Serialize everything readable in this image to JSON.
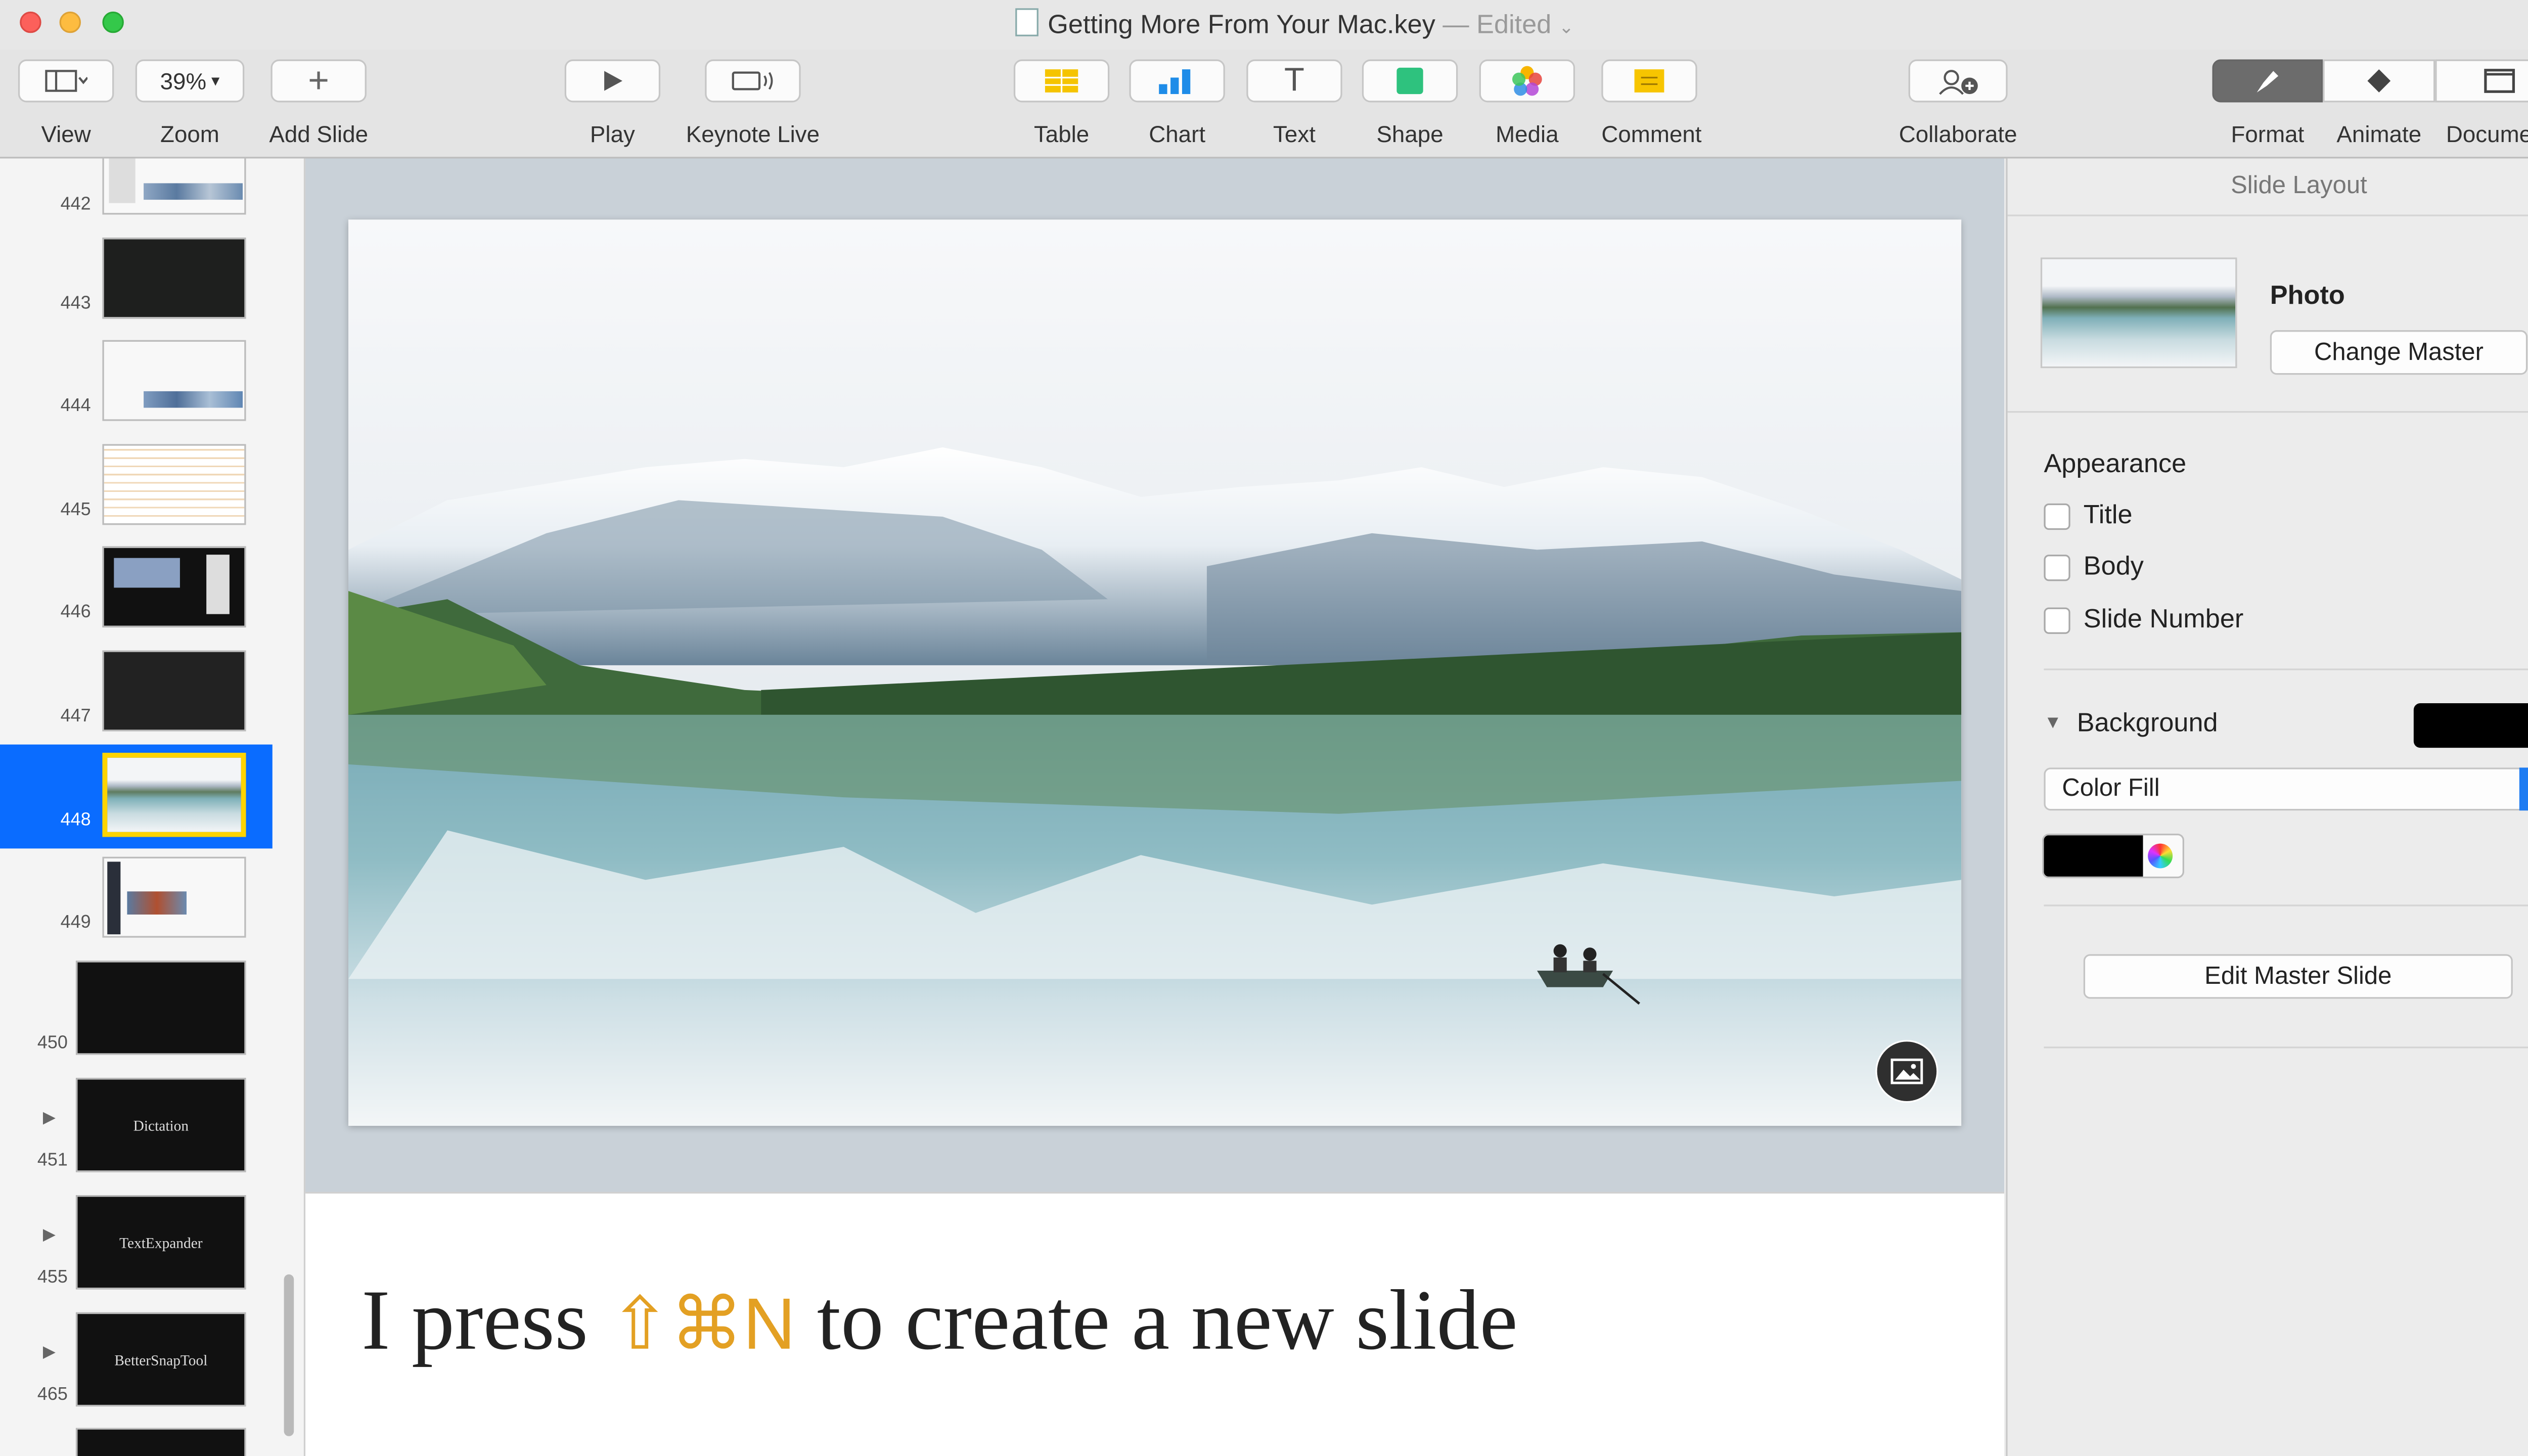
{
  "window": {
    "title": "Getting More From Your Mac.key",
    "edited": "— Edited"
  },
  "toolbar": {
    "view": "View",
    "zoom": "Zoom",
    "zoom_value": "39%",
    "add_slide": "Add Slide",
    "play": "Play",
    "keynote_live": "Keynote Live",
    "table": "Table",
    "chart": "Chart",
    "text": "Text",
    "shape": "Shape",
    "media": "Media",
    "comment": "Comment",
    "collaborate": "Collaborate",
    "format": "Format",
    "animate": "Animate",
    "document": "Document"
  },
  "slides": [
    {
      "num": "442",
      "style": "light"
    },
    {
      "num": "443",
      "style": "dark"
    },
    {
      "num": "444",
      "style": "light"
    },
    {
      "num": "445",
      "style": "light"
    },
    {
      "num": "446",
      "style": "dark"
    },
    {
      "num": "447",
      "style": "dark"
    },
    {
      "num": "448",
      "style": "photo",
      "selected": true
    },
    {
      "num": "449",
      "style": "light"
    },
    {
      "num": "450",
      "style": "dark"
    },
    {
      "num": "451",
      "style": "dark",
      "label": "Dictation",
      "group": true
    },
    {
      "num": "455",
      "style": "dark",
      "label": "TextExpander",
      "group": true
    },
    {
      "num": "465",
      "style": "dark",
      "label": "BetterSnapTool",
      "group": true
    }
  ],
  "notes": {
    "before": "I press",
    "keys": "⇧⌘N",
    "after": "to create a new slide"
  },
  "inspector": {
    "header": "Slide Layout",
    "master_name": "Photo",
    "change_master": "Change Master",
    "appearance": "Appearance",
    "title_cb": "Title",
    "body_cb": "Body",
    "slide_number_cb": "Slide Number",
    "background": "Background",
    "fill_type": "Color Fill",
    "edit_master": "Edit Master Slide",
    "bg_color": "#000000"
  },
  "colors": {
    "selection": "#0a6cff",
    "accent_keys": "#e3a023"
  }
}
